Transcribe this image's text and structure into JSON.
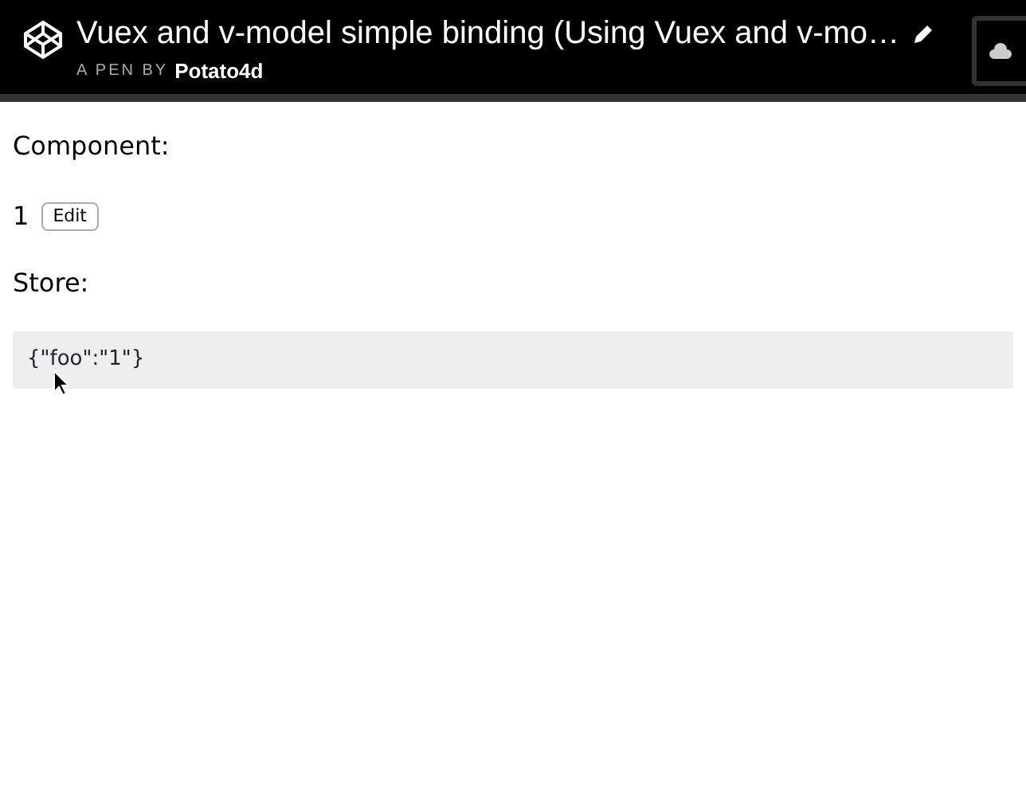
{
  "header": {
    "title": "Vuex and v-model simple binding (Using Vuex and v-mo…",
    "byline": "A PEN BY",
    "author": "Potato4d"
  },
  "content": {
    "component_label": "Component:",
    "value": "1",
    "edit_button": "Edit",
    "store_label": "Store:",
    "store_json": "{\"foo\":\"1\"}"
  }
}
